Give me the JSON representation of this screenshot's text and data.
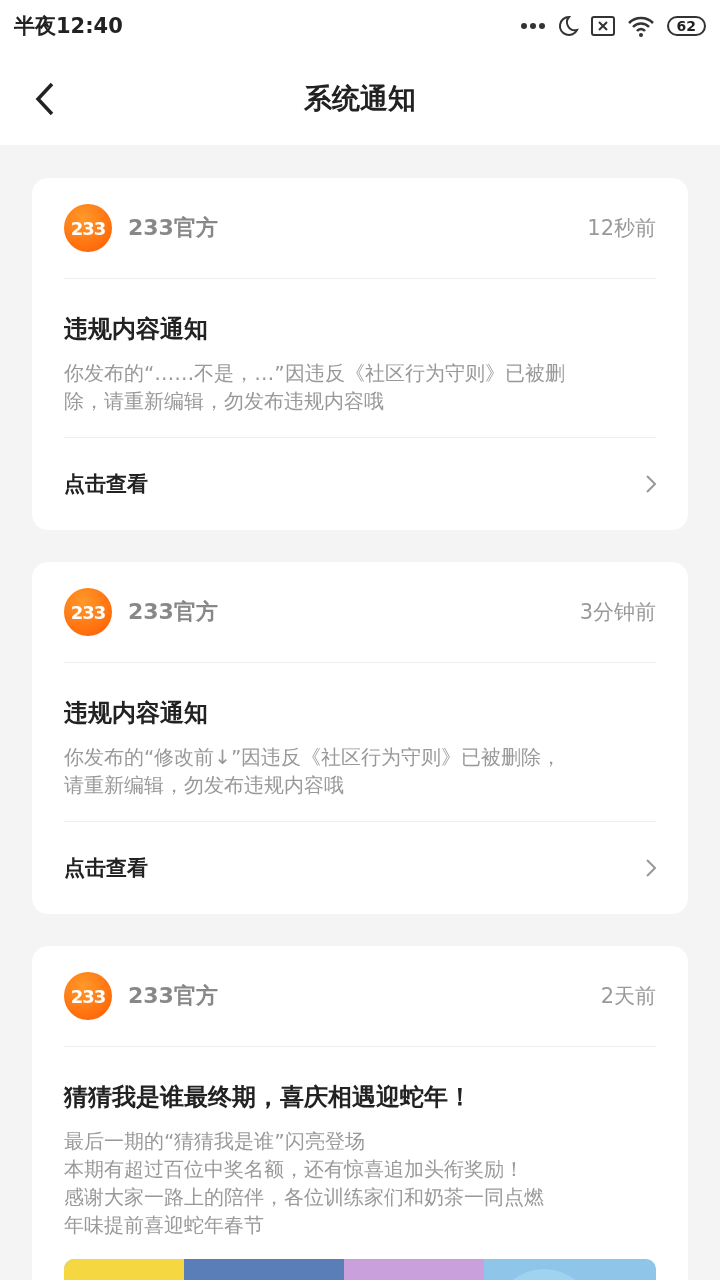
{
  "status_bar": {
    "time": "半夜12:40",
    "battery": "62"
  },
  "header": {
    "title": "系统通知"
  },
  "notifications": [
    {
      "sender": "233官方",
      "logo": "233",
      "time": "12秒前",
      "title": "违规内容通知",
      "body": [
        "你发布的“……不是，…”因违反《社区行为守则》已被删",
        "除，请重新编辑，勿发布违规内容哦"
      ],
      "action": "点击查看"
    },
    {
      "sender": "233官方",
      "logo": "233",
      "time": "3分钟前",
      "title": "违规内容通知",
      "body": [
        "你发布的“修改前↓”因违反《社区行为守则》已被删除，",
        "请重新编辑，勿发布违规内容哦"
      ],
      "action": "点击查看"
    },
    {
      "sender": "233官方",
      "logo": "233",
      "time": "2天前",
      "title": "猜猜我是谁最终期，喜庆相遇迎蛇年！",
      "body": [
        "最后一期的“猜猜我是谁”闪亮登场",
        "本期有超过百位中奖名额，还有惊喜追加头衔奖励！",
        "感谢大家一路上的陪伴，各位训练家们和奶茶一同点燃",
        "年味提前喜迎蛇年春节"
      ]
    }
  ]
}
